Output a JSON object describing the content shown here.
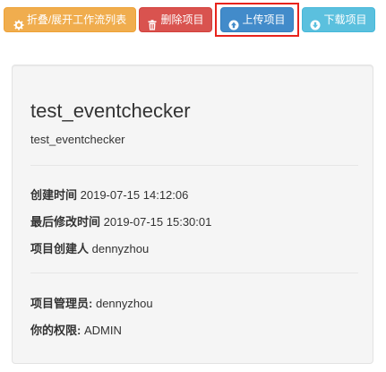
{
  "toolbar": {
    "buttons": [
      {
        "label": "折叠/展开工作流列表",
        "icon": "gear-icon",
        "color": "#f0ad4e"
      },
      {
        "label": "删除项目",
        "icon": "trash-icon",
        "color": "#d9534f"
      },
      {
        "label": "上传项目",
        "icon": "upload-circle-icon",
        "color": "#428bca"
      },
      {
        "label": "下载项目",
        "icon": "download-circle-icon",
        "color": "#5bc0de"
      }
    ]
  },
  "highlight": {
    "color": "#e8231c",
    "target": "上传项目"
  },
  "project": {
    "title": "test_eventchecker",
    "description": "test_eventchecker",
    "created_label": "创建时间",
    "created_value": "2019-07-15 14:12:06",
    "modified_label": "最后修改时间",
    "modified_value": "2019-07-15 15:30:01",
    "creator_label": "项目创建人",
    "creator_value": "dennyzhou",
    "admin_label": "项目管理员:",
    "admin_value": "dennyzhou",
    "permission_label": "你的权限:",
    "permission_value": "ADMIN"
  }
}
